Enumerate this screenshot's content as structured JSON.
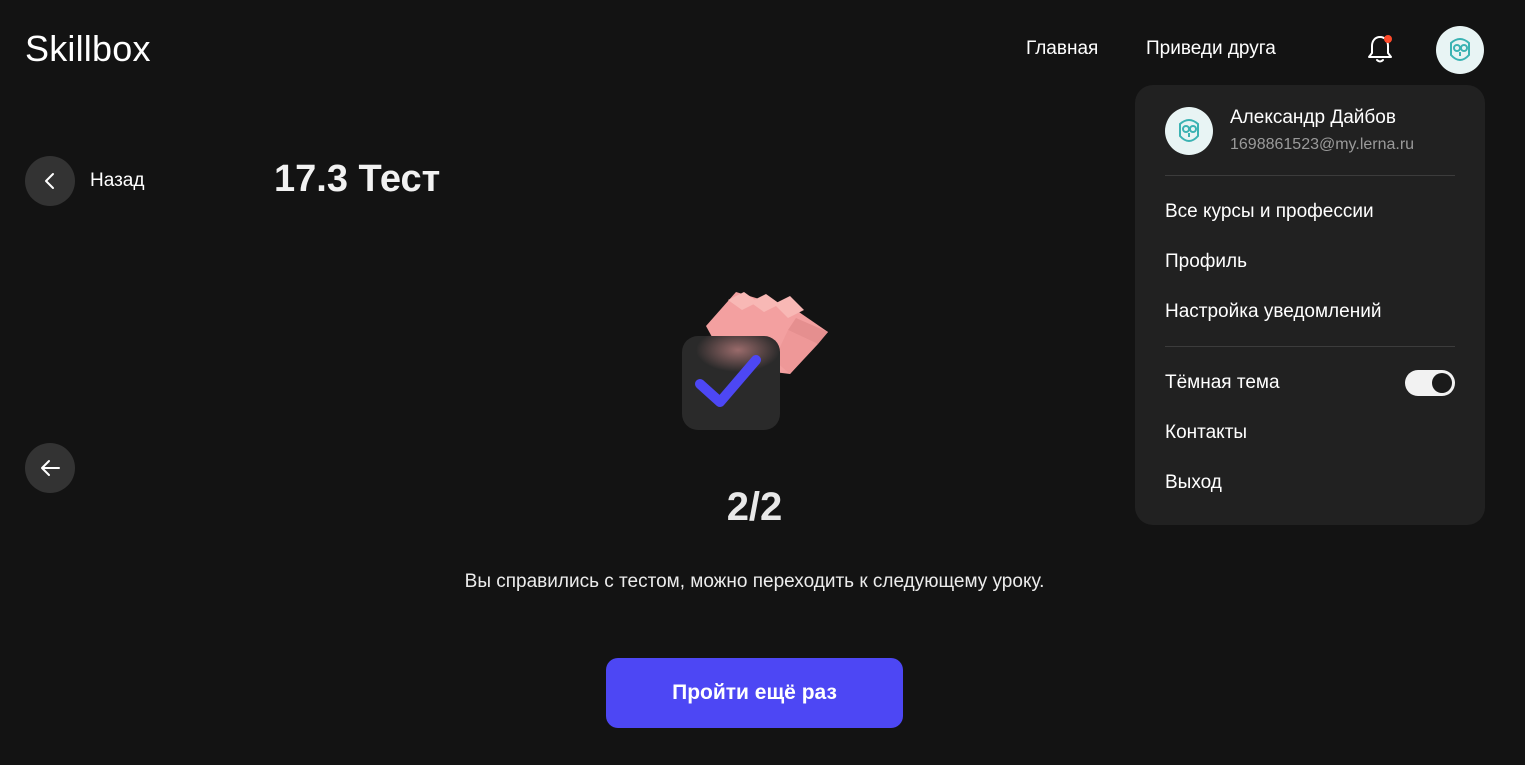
{
  "header": {
    "logo": "Skillbox",
    "nav": {
      "home": "Главная",
      "invite": "Приведи друга"
    },
    "icons": {
      "notifications": "bell-icon",
      "avatar": "owl-avatar-icon"
    },
    "notification_dot_color": "#ff4a2a"
  },
  "lesson": {
    "back_label": "Назад",
    "title": "17.3 Тест",
    "score": "2/2",
    "message": "Вы справились с тестом, можно переходить к следующему уроку.",
    "retry_label": "Пройти ещё раз"
  },
  "user_menu": {
    "name": "Александр Дайбов",
    "email": "1698861523@my.lerna.ru",
    "items": {
      "courses": "Все курсы и профессии",
      "profile": "Профиль",
      "notifications_settings": "Настройка уведомлений",
      "dark_theme": "Тёмная тема",
      "contacts": "Контакты",
      "logout": "Выход"
    },
    "dark_theme_enabled": true
  },
  "colors": {
    "background": "#131313",
    "accent": "#4d47f4",
    "menu_background": "#212121",
    "avatar_teal": "#3bb3b3"
  }
}
